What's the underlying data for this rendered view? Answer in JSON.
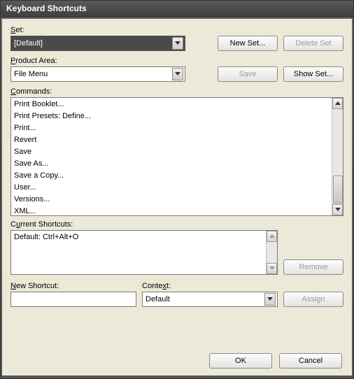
{
  "window": {
    "title": "Keyboard Shortcuts"
  },
  "labels": {
    "set": "Set:",
    "product_area": "Product Area:",
    "commands": "Commands:",
    "current_shortcuts": "Current Shortcuts:",
    "new_shortcut": "New Shortcut:",
    "context": "Context:"
  },
  "set": {
    "selected": "[Default]"
  },
  "product_area": {
    "selected": "File Menu"
  },
  "commands": {
    "items": [
      "Print Booklet...",
      "Print Presets: Define...",
      "Print...",
      "Revert",
      "Save",
      "Save As...",
      "Save a Copy...",
      "User...",
      "Versions...",
      "XML..."
    ]
  },
  "current_shortcuts": {
    "items": [
      "Default: Ctrl+Alt+O"
    ]
  },
  "new_shortcut": {
    "value": ""
  },
  "context": {
    "selected": "Default"
  },
  "buttons": {
    "new_set": "New Set...",
    "delete_set": "Delete Set",
    "save": "Save",
    "show_set": "Show Set...",
    "remove": "Remove",
    "assign": "Assign",
    "ok": "OK",
    "cancel": "Cancel"
  }
}
